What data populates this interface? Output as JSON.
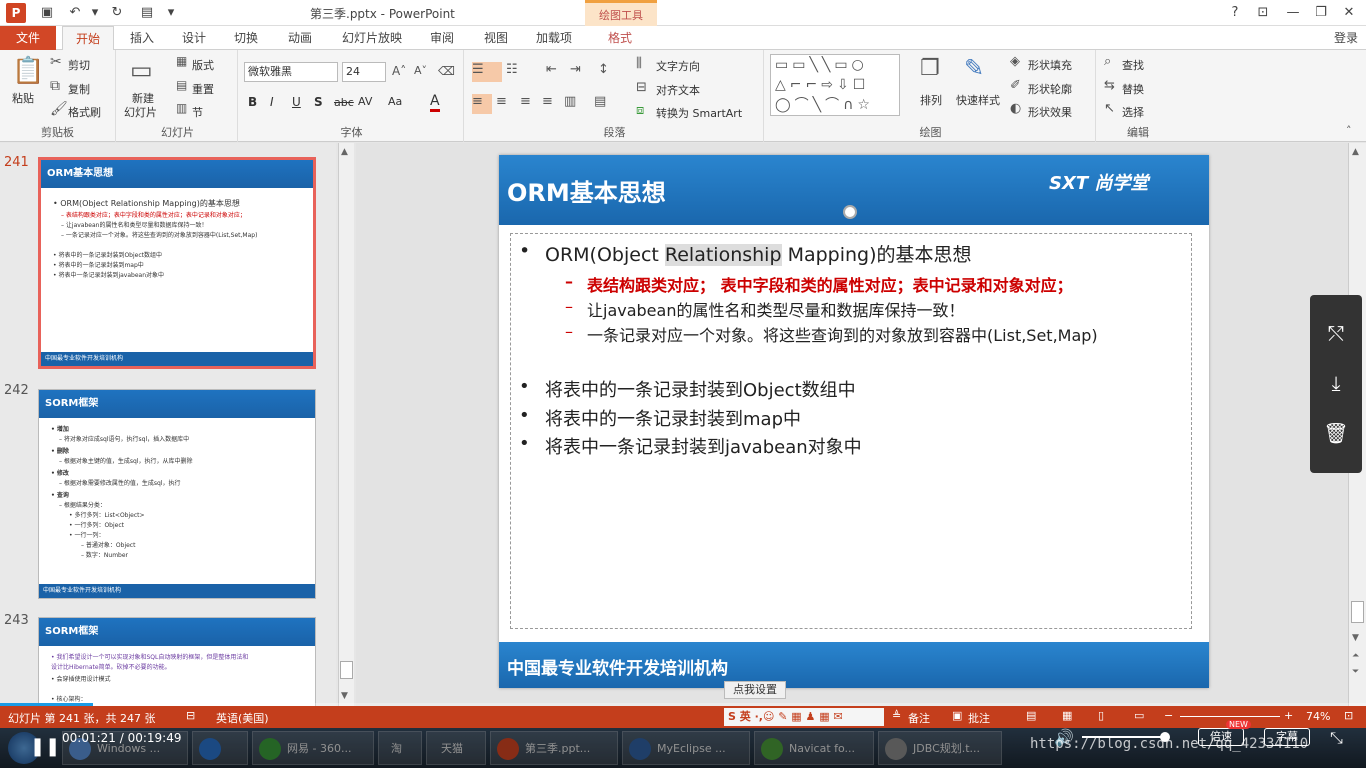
{
  "titlebar": {
    "title": "第三季.pptx - PowerPoint",
    "context_tab": "绘图工具",
    "logo": "P",
    "help": "?"
  },
  "tabs": [
    "文件",
    "开始",
    "插入",
    "设计",
    "切换",
    "动画",
    "幻灯片放映",
    "审阅",
    "视图",
    "加载项",
    "格式"
  ],
  "login": "登录",
  "ribbon": {
    "clipboard": {
      "label": "剪贴板",
      "paste": "粘贴",
      "cut": "剪切",
      "copy": "复制",
      "painter": "格式刷"
    },
    "slides": {
      "label": "幻灯片",
      "new_slide": "新建",
      "new_slide2": "幻灯片",
      "layout": "版式",
      "reset": "重置",
      "section": "节"
    },
    "font": {
      "label": "字体",
      "font_name": "微软雅黑",
      "font_size": "24",
      "bold": "B",
      "italic": "I",
      "underline": "U",
      "shadow": "S",
      "strike": "abc",
      "spacing": "AV",
      "case": "Aa",
      "color": "A"
    },
    "paragraph": {
      "label": "段落",
      "text_dir": "文字方向",
      "align_text": "对齐文本",
      "smartart": "转换为 SmartArt"
    },
    "drawing": {
      "label": "绘图",
      "arrange": "排列",
      "quick_styles": "快速样式",
      "fill": "形状填充",
      "outline": "形状轮廓",
      "effects": "形状效果"
    },
    "editing": {
      "label": "编辑",
      "find": "查找",
      "replace": "替换",
      "select": "选择"
    }
  },
  "thumbnails": [
    {
      "num": "241",
      "title": "ORM基本思想",
      "footer": "中国最专业软件开发培训机构",
      "lines": [
        {
          "t": "• ORM(Object Relationship Mapping)的基本思想",
          "red": false
        },
        {
          "t": "– 表结构跟类对应；表中字段和类的属性对应；表中记录和对象对应；",
          "red": true
        },
        {
          "t": "– 让javabean的属性名和类型尽量和数据库保持一致！",
          "red": false
        },
        {
          "t": "– 一条记录对应一个对象。将这些查询到的对象放到容器中(List,Set,Map)",
          "red": false
        },
        {
          "t": "• 将表中的一条记录封装到Object数组中",
          "red": false
        },
        {
          "t": "• 将表中的一条记录封装到map中",
          "red": false
        },
        {
          "t": "• 将表中一条记录封装到javabean对象中",
          "red": false
        }
      ]
    },
    {
      "num": "242",
      "title": "SORM框架",
      "footer": "中国最专业软件开发培训机构",
      "lines": [
        {
          "t": "• 增加",
          "red": false
        },
        {
          "t": "– 将对象对应成sql语句，执行sql，插入数据库中",
          "red": false
        },
        {
          "t": "• 删除",
          "red": false
        },
        {
          "t": "– 根据对象主键的值，生成sql，执行，从库中删除",
          "red": false
        },
        {
          "t": "• 修改",
          "red": false
        },
        {
          "t": "– 根据对象需要修改属性的值，生成sql，执行",
          "red": false
        },
        {
          "t": "• 查询",
          "red": false
        },
        {
          "t": "– 根据结果分类：",
          "red": false
        },
        {
          "t": "• 多行多列：List<Object>",
          "red": false
        },
        {
          "t": "• 一行多列：Object",
          "red": false
        },
        {
          "t": "• 一行一列：",
          "red": false
        },
        {
          "t": "– 普通对象：Object",
          "red": false
        },
        {
          "t": "– 数字：Number",
          "red": false
        }
      ]
    },
    {
      "num": "243",
      "title": "SORM框架",
      "footer": "",
      "lines": [
        {
          "t": "• 我们希望设计一个可以实现对象和SQL自动映射的框架，但是整体用法和",
          "red": false
        },
        {
          "t": "  设计比Hibernate简单。砍掉不必要的功能。",
          "red": false
        },
        {
          "t": "• 会穿插使用设计模式",
          "red": false
        },
        {
          "t": "• 核心架构：",
          "red": false
        }
      ]
    }
  ],
  "slide": {
    "title": "ORM基本思想",
    "logo_text": "SXT 尚学堂",
    "footer": "中国最专业软件开发培训机构",
    "b1_pre": "ORM(Object ",
    "b1_hl": "Relationship",
    "b1_post": " Mapping)的基本思想",
    "sub": [
      {
        "t": "表结构跟类对应； 表中字段和类的属性对应；表中记录和对象对应；",
        "red": true
      },
      {
        "t": "让javabean的属性名和类型尽量和数据库保持一致！",
        "red": false
      },
      {
        "t": "一条记录对应一个对象。将这些查询到的对象放到容器中(List,Set,Map)",
        "red": false
      }
    ],
    "bullets": [
      "将表中的一条记录封装到Object数组中",
      "将表中的一条记录封装到map中",
      "将表中一条记录封装到javabean对象中"
    ]
  },
  "tooltip": "点我设置",
  "status": {
    "slide_info": "幻灯片 第 241 张，共 247 张",
    "lang": "英语(美国)",
    "notes": "备注",
    "comments": "批注",
    "zoom": "74%",
    "ime": "英"
  },
  "taskbar": [
    {
      "label": "Windows ...",
      "color": "#5a8fd6"
    },
    {
      "label": "",
      "color": "#2a70c8"
    },
    {
      "label": "网易 - 360...",
      "color": "#3a9a3a"
    },
    {
      "label": "淘",
      "color": "#e06010"
    },
    {
      "label": "天猫",
      "color": "#c00000"
    },
    {
      "label": "第三季.ppt...",
      "color": "#d04423"
    },
    {
      "label": "MyEclipse ...",
      "color": "#3060a0"
    },
    {
      "label": "Navicat fo...",
      "color": "#4a9a3a"
    },
    {
      "label": "JDBC规划.t...",
      "color": "#888888"
    }
  ],
  "video": {
    "current": "00:01:21",
    "total": "00:19:49",
    "speed": "倍速",
    "subtitle": "字幕",
    "new_badge": "NEW",
    "watermark": "https://blog.csdn.net/qq_42334110",
    "progress": 0.068
  }
}
